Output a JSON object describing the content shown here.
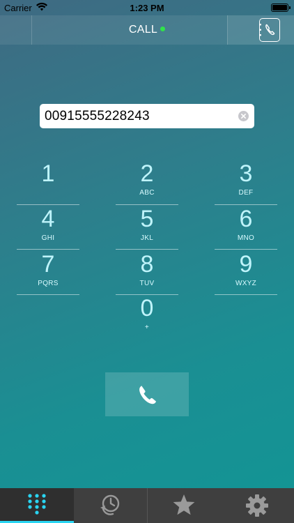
{
  "status_bar": {
    "carrier": "Carrier",
    "time": "1:23 PM"
  },
  "nav": {
    "title": "CALL",
    "status_color": "#30e34a"
  },
  "number_field": {
    "value": "00915555228243"
  },
  "keypad": [
    {
      "digit": "1",
      "letters": ""
    },
    {
      "digit": "2",
      "letters": "ABC"
    },
    {
      "digit": "3",
      "letters": "DEF"
    },
    {
      "digit": "4",
      "letters": "GHI"
    },
    {
      "digit": "5",
      "letters": "JKL"
    },
    {
      "digit": "6",
      "letters": "MNO"
    },
    {
      "digit": "7",
      "letters": "PQRS"
    },
    {
      "digit": "8",
      "letters": "TUV"
    },
    {
      "digit": "9",
      "letters": "WXYZ"
    },
    {
      "digit": "0",
      "letters": "+"
    }
  ],
  "tabs": [
    {
      "icon": "keypad-icon",
      "active": true
    },
    {
      "icon": "recents-icon",
      "active": false
    },
    {
      "icon": "star-icon",
      "active": false
    },
    {
      "icon": "gear-icon",
      "active": false
    }
  ],
  "colors": {
    "accent": "#29d5f2",
    "key_text": "#bff4fb",
    "tab_bar": "#3f3f3f"
  }
}
